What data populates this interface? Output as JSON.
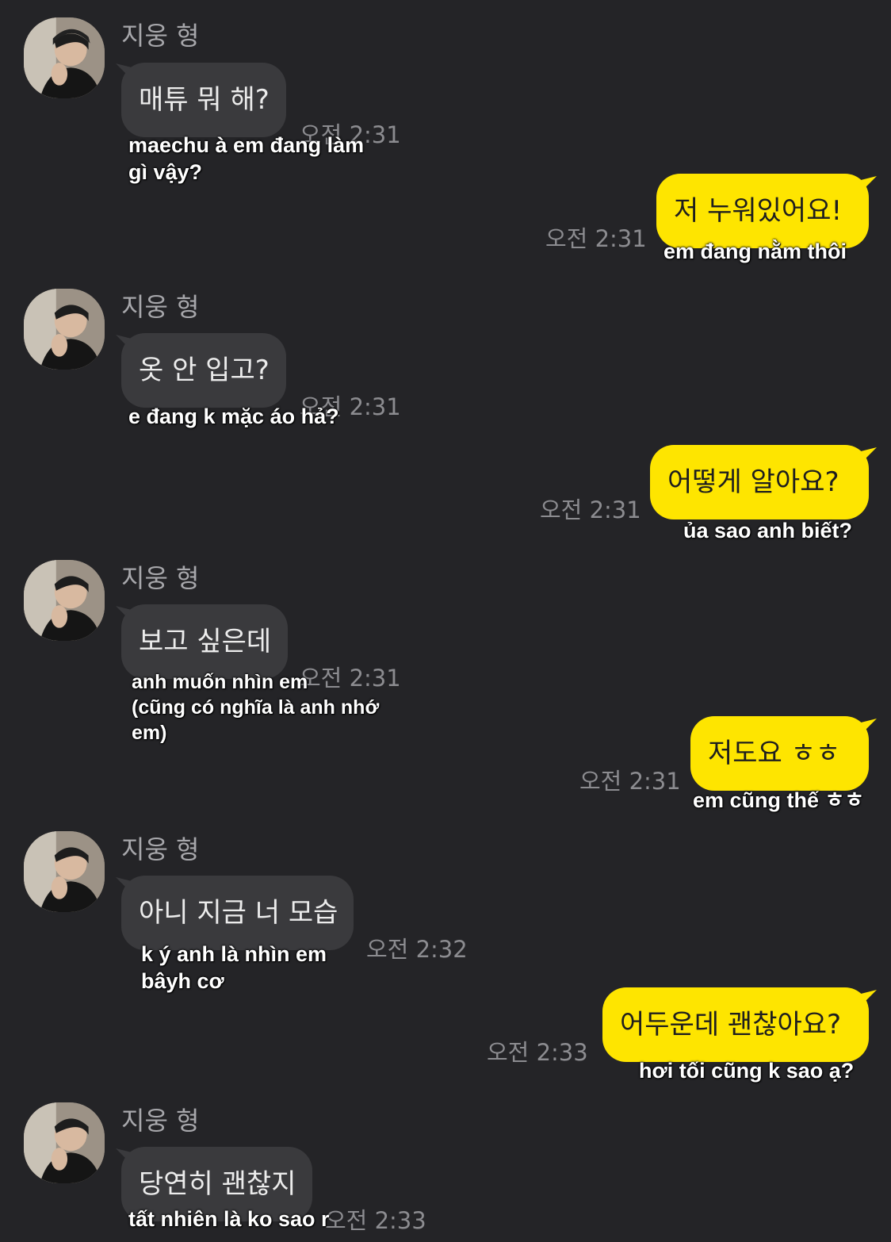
{
  "chat": {
    "contact_name": "지웅 형",
    "messages": [
      {
        "from": "contact",
        "text": "매튜 뭐 해?",
        "time": "오전 2:31",
        "caption": "maechu à em đang làm\ngì vậy?"
      },
      {
        "from": "me",
        "text": "저 누워있어요!",
        "time": "오전 2:31",
        "caption": "em đang nằm thôi"
      },
      {
        "from": "contact",
        "text": "옷 안 입고?",
        "time": "오전 2:31",
        "caption": "e đang k mặc áo hả?"
      },
      {
        "from": "me",
        "text": "어떻게 알아요?",
        "time": "오전 2:31",
        "caption": "ủa sao anh biết?"
      },
      {
        "from": "contact",
        "text": "보고 싶은데",
        "time": "오전 2:31",
        "caption": "anh muốn nhìn em\n(cũng có nghĩa là anh nhớ\nem)"
      },
      {
        "from": "me",
        "text": "저도요 ㅎㅎ",
        "time": "오전 2:31",
        "caption": "em cũng thế ㅎㅎ"
      },
      {
        "from": "contact",
        "text": "아니 지금 너 모습",
        "time": "오전 2:32",
        "caption": "k ý anh là nhìn em\nbâyh cơ"
      },
      {
        "from": "me",
        "text": "어두운데 괜찮아요?",
        "time": "오전 2:33",
        "caption": "hơi tối cũng k sao ạ?"
      },
      {
        "from": "contact",
        "text": "당연히 괜찮지",
        "time": "오전 2:33",
        "caption": "tất nhiên là ko sao r"
      }
    ]
  },
  "colors": {
    "background": "#242427",
    "incoming_bubble": "#3a3a3d",
    "outgoing_bubble": "#fee500",
    "time_text": "#8c8c90",
    "name_text": "#a7a7ab"
  }
}
